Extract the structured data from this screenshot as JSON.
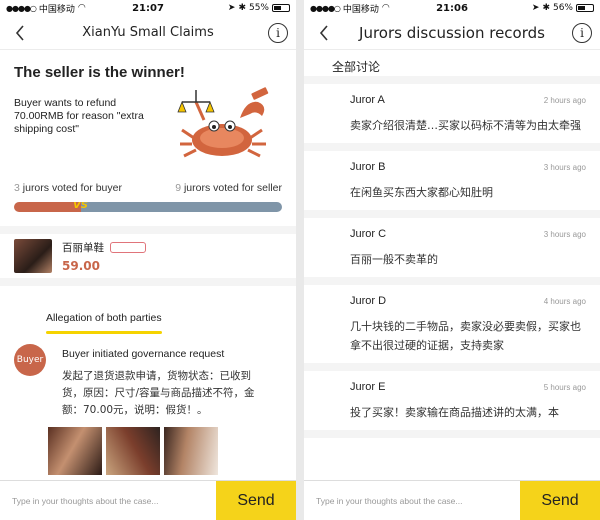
{
  "left": {
    "status": {
      "carrier": "中国移动",
      "time": "21:07",
      "battery": "55%",
      "battery_level": 0.55
    },
    "nav": {
      "title": "XianYu Small Claims",
      "info_icon": "i"
    },
    "verdict": {
      "headline": "The seller is the winner!",
      "reason": "Buyer wants to refund 70.00RMB for reason \"extra shipping cost\""
    },
    "votes": {
      "buyer_count": "3",
      "buyer_label": "jurors voted for buyer",
      "seller_count": "9",
      "seller_label": "jurors voted for seller",
      "vs_label": "VS",
      "buyer_share": 0.25,
      "colors": {
        "buyer": "#c8664a",
        "seller": "#7f95a8",
        "vs": "#f5c400"
      }
    },
    "product": {
      "name": "百丽单鞋",
      "price": "59.00"
    },
    "tab": {
      "label": "Allegation of both parties"
    },
    "post": {
      "avatar_label": "Buyer",
      "title": "Buyer initiated governance request",
      "text": "发起了退货退款申请，货物状态：已收到货，原因：尺寸/容量与商品描述不符，金额：70.00元，说明：假货！。"
    },
    "input": {
      "placeholder": "Type in your thoughts about the case...",
      "send_label": "Send"
    }
  },
  "right": {
    "status": {
      "carrier": "中国移动",
      "time": "21:06",
      "battery": "56%",
      "battery_level": 0.56
    },
    "nav": {
      "title": "Jurors discussion records",
      "info_icon": "i"
    },
    "section_title": "全部讨论",
    "jurors": [
      {
        "name": "Juror A",
        "time": "2 hours ago",
        "comment": "卖家介绍很清楚…买家以码标不清等为由太牵强"
      },
      {
        "name": "Juror B",
        "time": "3 hours ago",
        "comment": "在闲鱼买东西大家都心知肚明"
      },
      {
        "name": "Juror C",
        "time": "3 hours ago",
        "comment": "百丽一般不卖革的"
      },
      {
        "name": "Juror D",
        "time": "4 hours ago",
        "comment": "几十块钱的二手物品，卖家没必要卖假，买家也拿不出很过硬的证据，支持卖家"
      },
      {
        "name": "Juror E",
        "time": "5 hours ago",
        "comment": "投了买家！卖家输在商品描述讲的太满，本"
      }
    ],
    "input": {
      "placeholder": "Type in your thoughts about the case...",
      "send_label": "Send"
    }
  },
  "accent_color": "#f5d31a"
}
